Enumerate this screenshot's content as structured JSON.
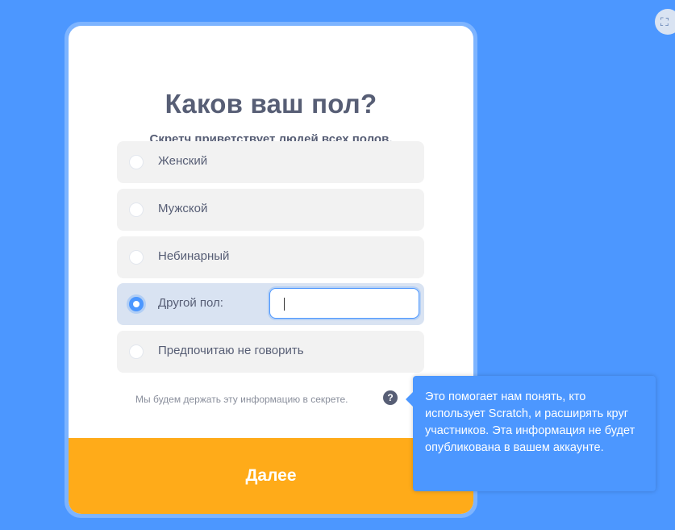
{
  "colors": {
    "background": "#4c97ff",
    "accent": "#4c97ff",
    "button": "#ffab19",
    "text": "#575e75"
  },
  "corner": {
    "icon": "screen-capture-icon"
  },
  "modal": {
    "title": "Каков ваш пол?",
    "subtitle": "Скретч приветствует людей всех полов.",
    "options": [
      {
        "label": "Женский",
        "selected": false
      },
      {
        "label": "Мужской",
        "selected": false
      },
      {
        "label": "Небинарный",
        "selected": false
      },
      {
        "label": "Другой пол:",
        "selected": true
      },
      {
        "label": "Предпочитаю не говорить",
        "selected": false
      }
    ],
    "other_input_value": "",
    "privacy_note": "Мы будем держать эту информацию в секрете.",
    "help_icon": "question-icon",
    "next_label": "Далее"
  },
  "tooltip": {
    "text": "Это помогает нам понять, кто использует Scratch, и расширять круг участников. Эта информация не будет опубликована в вашем аккаунте."
  }
}
